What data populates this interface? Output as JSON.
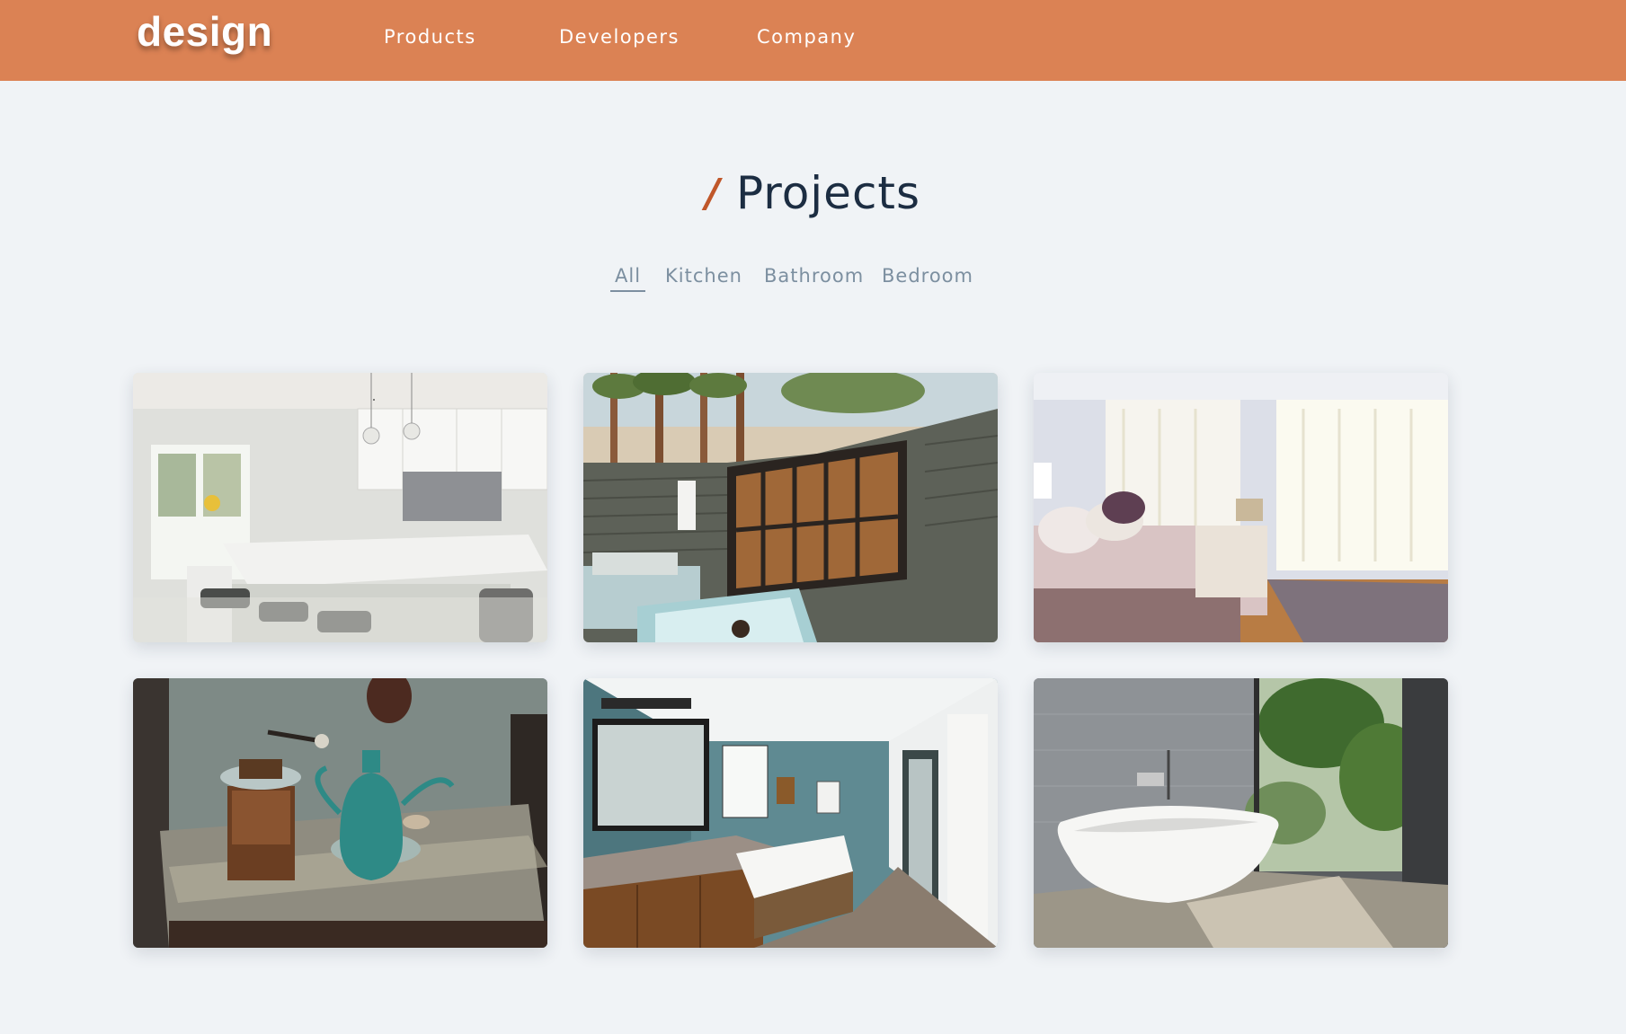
{
  "header": {
    "logo": "design",
    "nav": [
      "Products",
      "Developers",
      "Company"
    ]
  },
  "section": {
    "slash": "/",
    "title": "Projects"
  },
  "filters": {
    "items": [
      "All",
      "Kitchen",
      "Bathroom",
      "Bedroom"
    ],
    "active": "All"
  },
  "gallery": {
    "images": [
      {
        "subject": "white kitchen with island"
      },
      {
        "subject": "outdoor bath with palm trees"
      },
      {
        "subject": "bright bedroom with curtains"
      },
      {
        "subject": "coffee grinder and teal kettle"
      },
      {
        "subject": "bathroom with vanity and tub"
      },
      {
        "subject": "freestanding bathtub by window"
      }
    ]
  },
  "colors": {
    "header_bg": "#db8254",
    "accent": "#c0572a",
    "title": "#1c2d42",
    "filter_text": "#7c8fa0",
    "page_bg": "#f0f3f6"
  }
}
